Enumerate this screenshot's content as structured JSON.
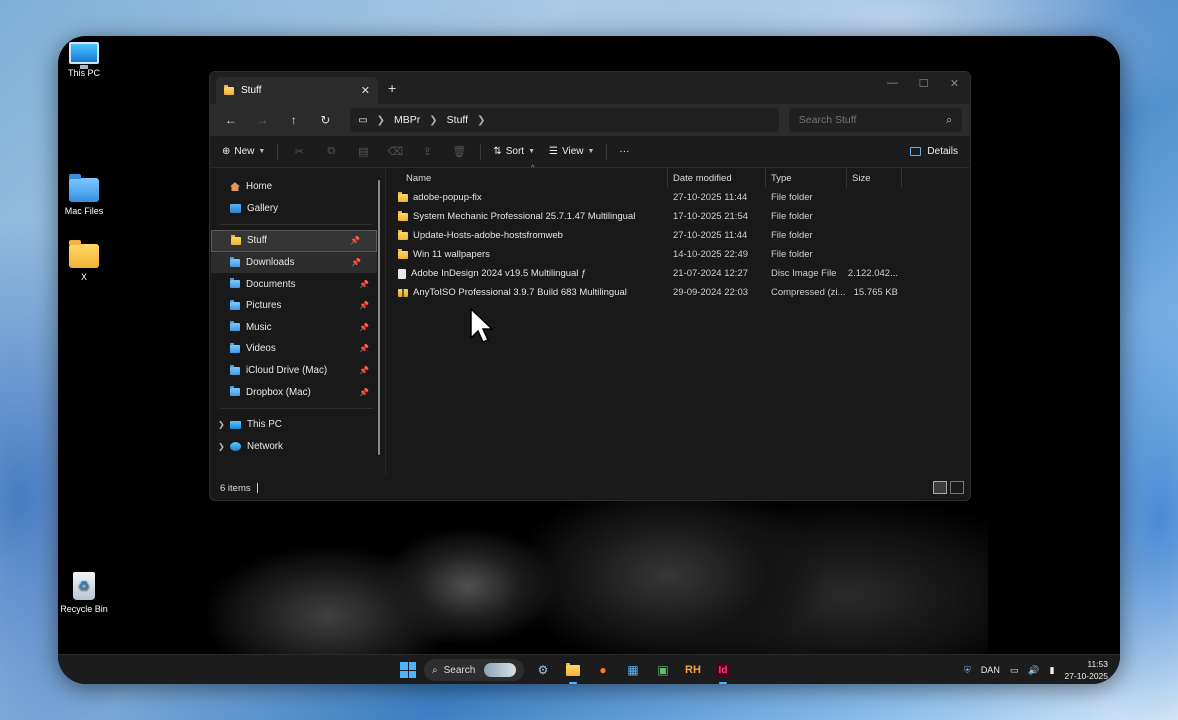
{
  "desktop": {
    "icons": [
      {
        "label": "This PC"
      },
      {
        "label": "Mac Files"
      },
      {
        "label": "X"
      },
      {
        "label": "Recycle Bin"
      }
    ]
  },
  "window": {
    "tab_title": "Stuff",
    "new_tab": "+",
    "controls": {
      "minimize": "—",
      "maximize": "☐",
      "close": "✕"
    }
  },
  "address": {
    "crumbs": [
      "MBPr",
      "Stuff"
    ],
    "search_placeholder": "Search Stuff"
  },
  "commands": {
    "new": "New",
    "sort": "Sort",
    "view": "View",
    "more": "···",
    "details": "Details"
  },
  "nav": {
    "home": "Home",
    "gallery": "Gallery",
    "quick_access": [
      "Stuff",
      "Downloads",
      "Documents",
      "Pictures",
      "Music",
      "Videos",
      "iCloud Drive (Mac)",
      "Dropbox (Mac)"
    ],
    "this_pc": "This PC",
    "network": "Network"
  },
  "columns": {
    "name": "Name",
    "date": "Date modified",
    "type": "Type",
    "size": "Size"
  },
  "files": [
    {
      "name": "adobe-popup-fix",
      "date": "27-10-2025 11:44",
      "type": "File folder",
      "size": "",
      "icon": "folder"
    },
    {
      "name": "System Mechanic Professional 25.7.1.47 Multilingual",
      "date": "17-10-2025 21:54",
      "type": "File folder",
      "size": "",
      "icon": "folder"
    },
    {
      "name": "Update-Hosts-adobe-hostsfromweb",
      "date": "27-10-2025 11:44",
      "type": "File folder",
      "size": "",
      "icon": "folder"
    },
    {
      "name": "Win 11 wallpapers",
      "date": "14-10-2025 22:49",
      "type": "File folder",
      "size": "",
      "icon": "folder"
    },
    {
      "name": "Adobe InDesign 2024 v19.5 Multilingual ƒ",
      "date": "21-07-2024 12:27",
      "type": "Disc Image File",
      "size": "2.122.042...",
      "icon": "disc"
    },
    {
      "name": "AnyToISO Professional 3.9.7 Build 683 Multilingual",
      "date": "29-09-2024 22:03",
      "type": "Compressed (zi...",
      "size": "15.765 KB",
      "icon": "zip"
    }
  ],
  "status": {
    "count": "6 items"
  },
  "taskbar": {
    "search": "Search",
    "lang": "DAN",
    "time": "11:53",
    "date": "27-10-2025",
    "rh": "RH",
    "id": "Id"
  }
}
